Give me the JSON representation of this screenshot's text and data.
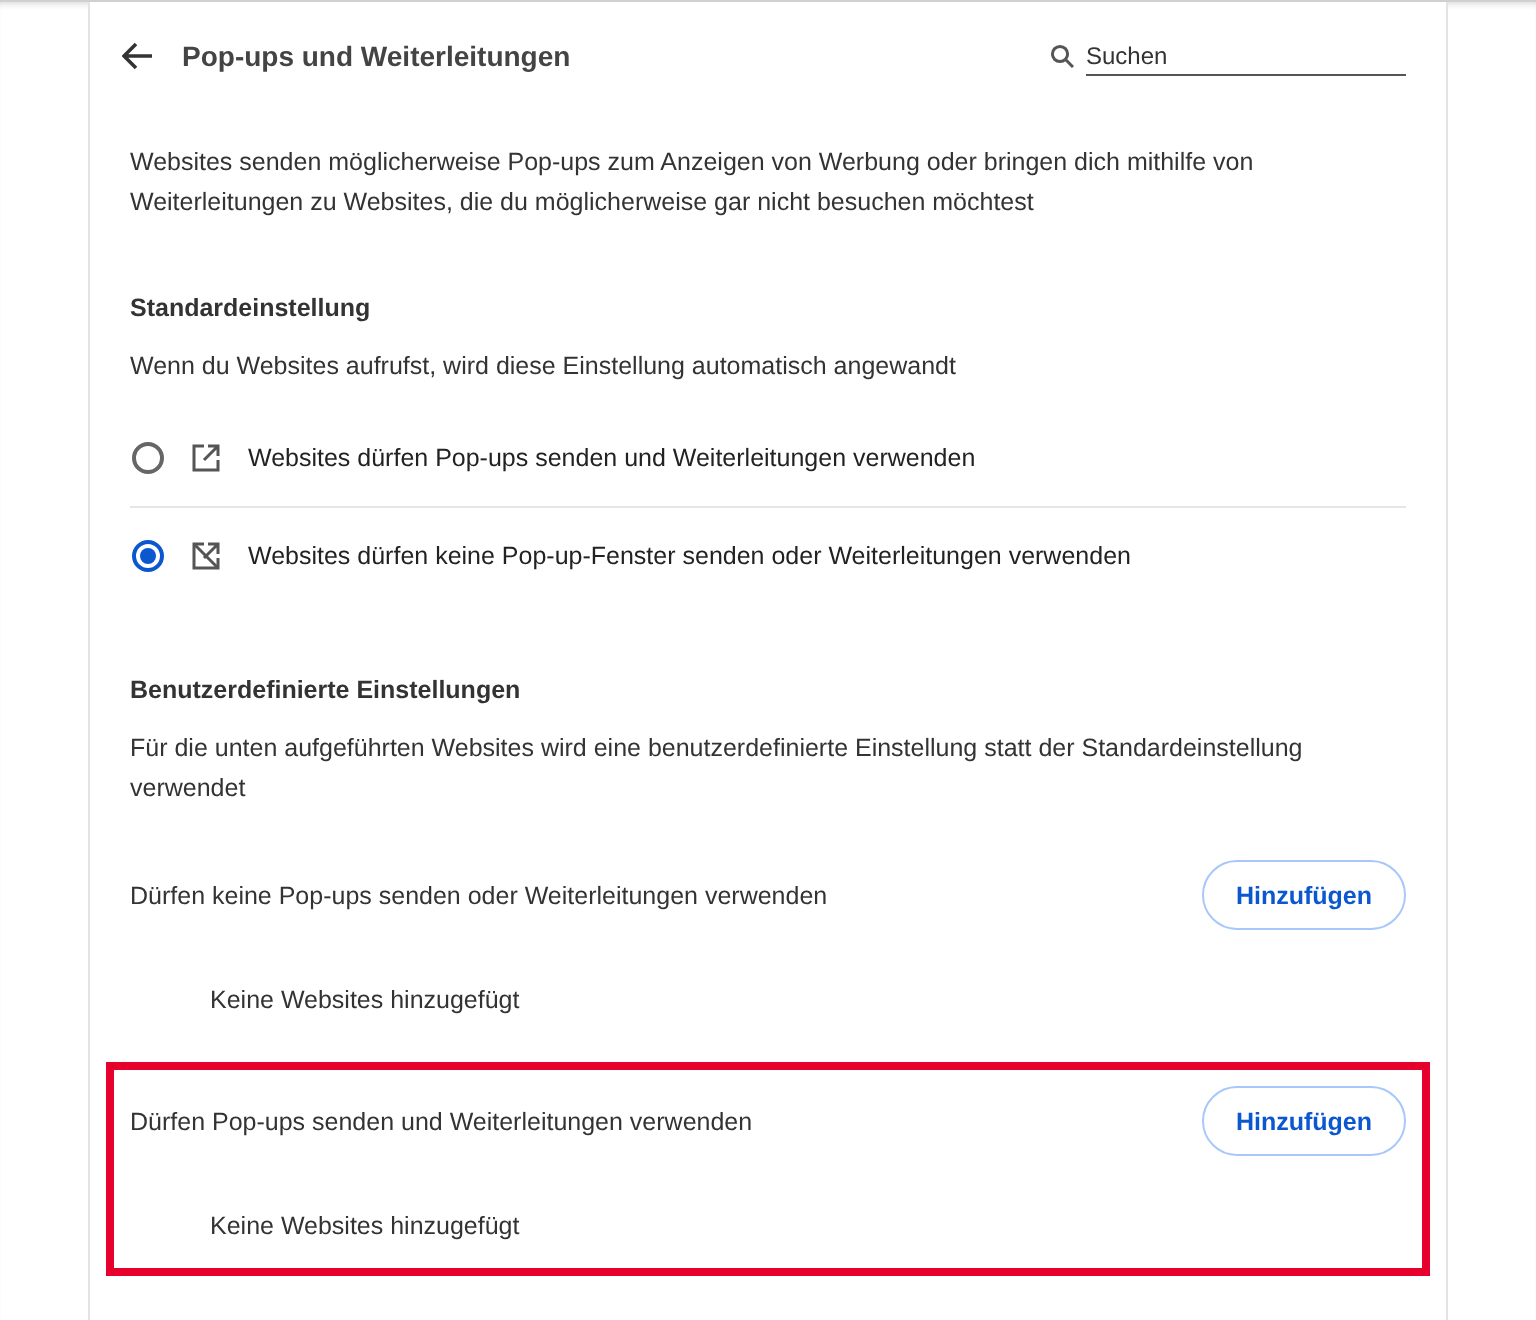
{
  "header": {
    "title": "Pop-ups und Weiterleitungen",
    "search": {
      "placeholder": "Suchen"
    }
  },
  "description": "Websites senden möglicherweise Pop-ups zum Anzeigen von Werbung oder bringen dich mithilfe von Weiterleitungen zu Websites, die du möglicherweise gar nicht besuchen möchtest",
  "default_setting": {
    "heading": "Standardeinstellung",
    "subtitle": "Wenn du Websites aufrufst, wird diese Einstellung automatisch angewandt",
    "options": [
      {
        "kind": "allow",
        "label": "Websites dürfen Pop-ups senden und Weiterleitungen verwenden",
        "selected": false
      },
      {
        "kind": "block",
        "label": "Websites dürfen keine Pop-up-Fenster senden oder Weiterleitungen verwenden",
        "selected": true
      }
    ]
  },
  "custom_settings": {
    "heading": "Benutzerdefinierte Einstellungen",
    "subtitle": "Für die unten aufgeführten Websites wird eine benutzerdefinierte Einstellung statt der Standardeinstellung verwendet",
    "sections": [
      {
        "title": "Dürfen keine Pop-ups senden oder Weiterleitungen verwenden",
        "button": "Hinzufügen",
        "empty_text": "Keine Websites hinzugefügt",
        "highlighted": false
      },
      {
        "title": "Dürfen Pop-ups senden und Weiterleitungen verwenden",
        "button": "Hinzufügen",
        "empty_text": "Keine Websites hinzugefügt",
        "highlighted": true
      }
    ]
  }
}
